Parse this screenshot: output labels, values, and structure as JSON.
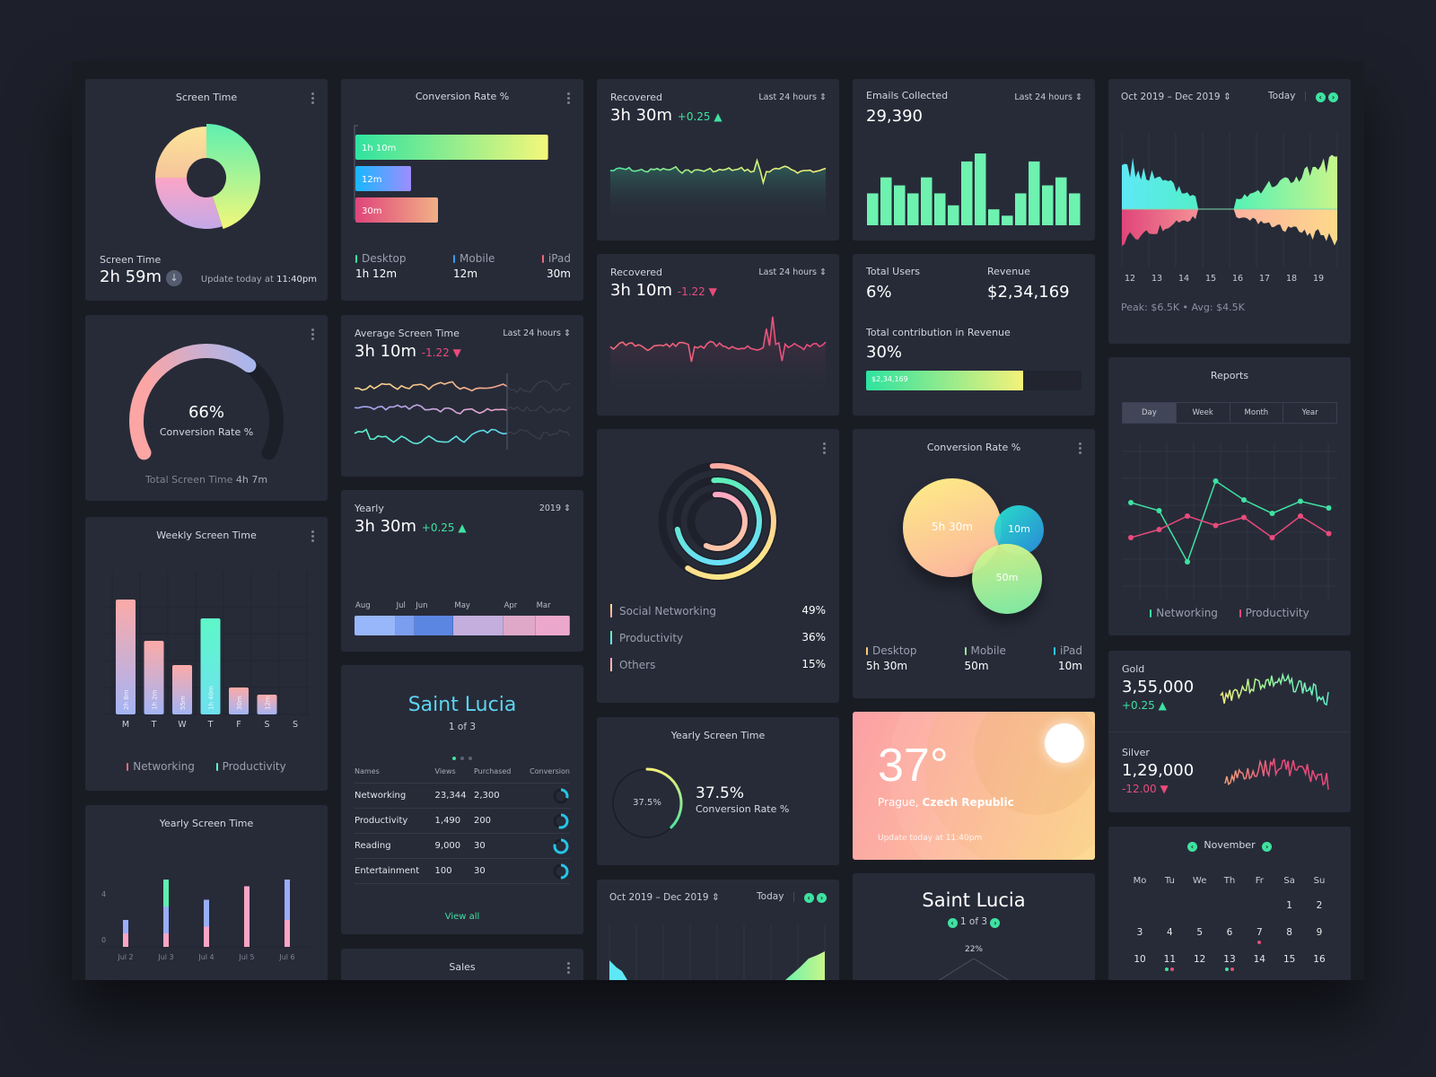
{
  "screen_time": {
    "title": "Screen Time",
    "label": "Screen Time",
    "value": "2h 59m",
    "update": "Update today at ",
    "update_time": "11:40pm",
    "donut_shares": [
      0.45,
      0.3,
      0.25
    ]
  },
  "conversion_bars": {
    "title": "Conversion Rate %",
    "bars": [
      {
        "label": "1h 10m",
        "minutes": 70
      },
      {
        "label": "12m",
        "minutes": 12
      },
      {
        "label": "30m",
        "minutes": 30
      }
    ],
    "legend": [
      {
        "name": "Desktop",
        "value": "1h 12m",
        "color": "#3ee2a0"
      },
      {
        "name": "Mobile",
        "value": "12m",
        "color": "#3b9bff"
      },
      {
        "name": "iPad",
        "value": "30m",
        "color": "#f06a7a"
      }
    ]
  },
  "recovered_up": {
    "title": "Recovered",
    "range": "Last 24 hours",
    "value": "3h 30m",
    "delta": "+0.25 ▲"
  },
  "recovered_down": {
    "title": "Recovered",
    "range": "Last 24 hours",
    "value": "3h 10m",
    "delta": "-1.22 ▼"
  },
  "emails": {
    "title": "Emails Collected",
    "range": "Last 24 hours",
    "value": "29,390",
    "bars": [
      4,
      6,
      5,
      4,
      6,
      4,
      2.5,
      8,
      9,
      2,
      1.2,
      4,
      8,
      5,
      6,
      4
    ]
  },
  "range_chart_top": {
    "range": "Oct 2019 – Dec 2019",
    "today": "Today",
    "x_labels": [
      "12",
      "13",
      "14",
      "15",
      "16",
      "17",
      "18",
      "19"
    ],
    "peak": "Peak: $6.5K",
    "sep": "•",
    "avg": "Avg: $4.5K"
  },
  "gauge": {
    "value": "66%",
    "label": "Conversion Rate %",
    "fraction": 0.66,
    "total_label": "Total Screen Time ",
    "total_value": "4h 7m"
  },
  "avg_screen": {
    "title": "Average Screen Time",
    "range": "Last 24 hours",
    "value": "3h 10m",
    "delta": "-1.22 ▼"
  },
  "users": {
    "total_users_label": "Total Users",
    "total_users": "6%",
    "revenue_label": "Revenue",
    "revenue": "$2,34,169",
    "contribution_label": "Total contribution in Revenue",
    "contribution": "30%",
    "bar_label": "$2,34,169",
    "bar_fraction": 0.73
  },
  "reports": {
    "title": "Reports",
    "tabs": [
      "Day",
      "Week",
      "Month",
      "Year"
    ],
    "active_tab": 0,
    "networking": [
      7.2,
      6.6,
      2.8,
      8.8,
      7.4,
      6.4,
      7.3,
      6.8
    ],
    "productivity": [
      4.6,
      5.2,
      6.2,
      5.5,
      6.1,
      4.6,
      6.2,
      4.9
    ],
    "legend": [
      "Networking",
      "Productivity"
    ]
  },
  "weekly": {
    "title": "Weekly Screen Time",
    "days": [
      "M",
      "T",
      "W",
      "T",
      "F",
      "S",
      "S"
    ],
    "labels": [
      "2h 8m",
      "1h 2m",
      "55m",
      "1h 40m",
      "30m",
      "12m",
      ""
    ],
    "values": [
      128,
      82,
      55,
      107,
      30,
      22,
      0
    ],
    "highlight": 3,
    "legend": [
      "Networking",
      "Productivity"
    ]
  },
  "yearly_strip": {
    "title": "Yearly",
    "range": "2019",
    "value": "3h 30m",
    "delta": "+0.25 ▲",
    "months": [
      "Aug",
      "Jul",
      "Jun",
      "May",
      "Apr",
      "Mar"
    ]
  },
  "rings": {
    "legend": [
      {
        "name": "Social Networking",
        "value": "49%"
      },
      {
        "name": "Productivity",
        "value": "36%"
      },
      {
        "name": "Others",
        "value": "15%"
      }
    ],
    "fractions": [
      0.49,
      0.75,
      0.6
    ]
  },
  "bubbles": {
    "title": "Conversion Rate %",
    "items": [
      {
        "label": "5h 30m"
      },
      {
        "label": "10m"
      },
      {
        "label": "50m"
      }
    ],
    "legend": [
      {
        "name": "Desktop",
        "value": "5h 30m",
        "color": "#f7c97a"
      },
      {
        "name": "Mobile",
        "value": "50m",
        "color": "#9fe59a"
      },
      {
        "name": "iPad",
        "value": "10m",
        "color": "#2fc9e0"
      }
    ]
  },
  "gold": {
    "name": "Gold",
    "value": "3,55,000",
    "delta": "+0.25 ▲"
  },
  "silver": {
    "name": "Silver",
    "value": "1,29,000",
    "delta": "-12.00 ▼"
  },
  "yearly_stacked": {
    "title": "Yearly Screen Time",
    "y_ticks": [
      "4",
      "0"
    ],
    "x": [
      "Jul 2",
      "Jul 3",
      "Jul 4",
      "Jul 5",
      "Jul 6"
    ],
    "pink": [
      1,
      1,
      1.5,
      4.5,
      2
    ],
    "blue": [
      1,
      2,
      2,
      0,
      3
    ],
    "green": [
      0,
      2,
      0,
      0,
      0
    ]
  },
  "saint_lucia_table": {
    "title": "Saint Lucia",
    "page": "1 of 3",
    "columns": [
      "Names",
      "Views",
      "Purchased",
      "Conversion"
    ],
    "rows": [
      {
        "name": "Networking",
        "views": "23,344",
        "purchased": "2,300",
        "conversion": 0.3
      },
      {
        "name": "Productivity",
        "views": "1,490",
        "purchased": "200",
        "conversion": 0.55
      },
      {
        "name": "Reading",
        "views": "9,000",
        "purchased": "30",
        "conversion": 0.8
      },
      {
        "name": "Entertainment",
        "views": "100",
        "purchased": "30",
        "conversion": 0.5
      }
    ],
    "view_all": "View all"
  },
  "sales": {
    "title": "Sales"
  },
  "yearly_ring": {
    "title": "Yearly Screen Time",
    "inner": "37.5%",
    "value": "37.5%",
    "label": "Conversion Rate %",
    "fraction": 0.375
  },
  "weather": {
    "temp": "37°",
    "city": "Prague, ",
    "country": "Czech Republic",
    "update": "Update today at 11:40pm"
  },
  "range_chart_bottom": {
    "range": "Oct 2019 – Dec 2019",
    "today": "Today"
  },
  "saint_lucia_radar": {
    "title": "Saint Lucia",
    "page": "1 of 3",
    "pct": "22%"
  },
  "calendar": {
    "month": "November",
    "weekdays": [
      "Mo",
      "Tu",
      "We",
      "Th",
      "Fr",
      "Sa",
      "Su"
    ],
    "weeks": [
      [
        "",
        "",
        "",
        "",
        "",
        "1",
        "2"
      ],
      [
        "3",
        "4",
        "5",
        "6",
        "7",
        "8",
        "9"
      ],
      [
        "10",
        "11",
        "12",
        "13",
        "14",
        "15",
        "16"
      ]
    ],
    "events": {
      "7": [
        "#e94b7b"
      ],
      "11": [
        "#3ee2a0",
        "#e94b7b"
      ],
      "13": [
        "#3ee2a0",
        "#e94b7b"
      ]
    }
  }
}
